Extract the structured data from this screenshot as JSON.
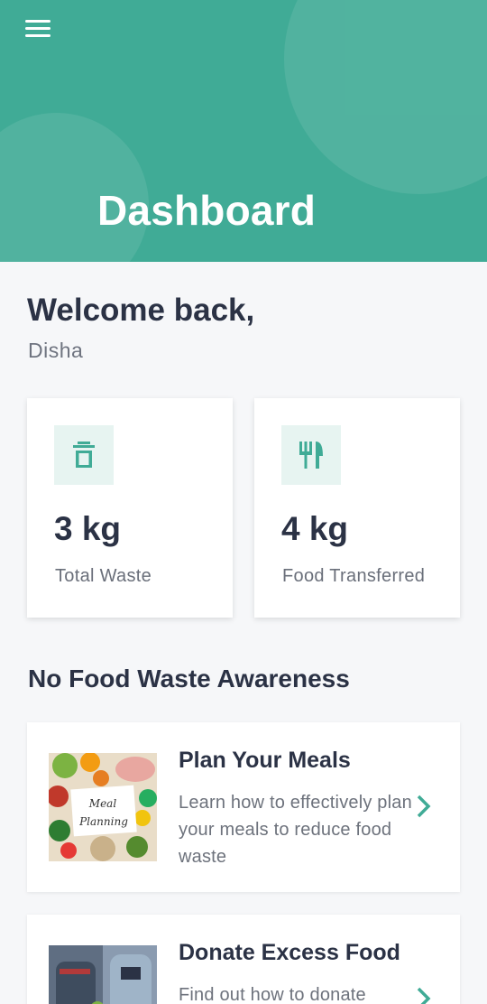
{
  "header": {
    "title": "Dashboard",
    "menu_icon": "hamburger-menu-icon",
    "background_color": "#40ab96"
  },
  "welcome": {
    "greeting": "Welcome back,",
    "user_name": "Disha"
  },
  "stats": [
    {
      "icon": "trash-bin-icon",
      "value": "3 kg",
      "label": "Total Waste"
    },
    {
      "icon": "fork-knife-icon",
      "value": "4 kg",
      "label": "Food Transferred"
    }
  ],
  "awareness": {
    "section_title": "No Food Waste Awareness",
    "articles": [
      {
        "title": "Plan Your Meals",
        "description": "Learn how to effectively plan your meals to reduce food waste",
        "image_text_line1": "Meal",
        "image_text_line2": "Planning"
      },
      {
        "title": "Donate Excess Food",
        "description": "Find out how to donate"
      }
    ]
  },
  "colors": {
    "accent": "#40ab96",
    "icon_bg": "#e7f4f1",
    "text_dark": "#2b3245",
    "text_muted": "#6d727c"
  }
}
